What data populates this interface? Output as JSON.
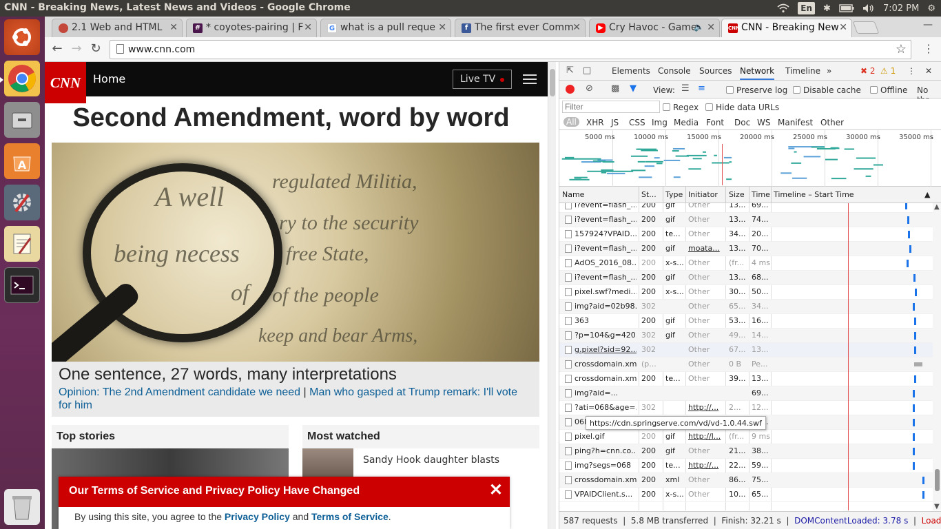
{
  "window": {
    "title": "CNN - Breaking News, Latest News and Videos - Google Chrome"
  },
  "indicators": {
    "lang": "En",
    "time": "7:02 PM"
  },
  "tabs": [
    {
      "label": "2.1 Web and HTML",
      "color": "#c3473a"
    },
    {
      "label": "* coyotes-pairing | F",
      "color": "#4a154b"
    },
    {
      "label": "what is a pull reque",
      "color": "#4285f4"
    },
    {
      "label": "The first ever Comm",
      "color": "#3b5998"
    },
    {
      "label": "Cry Havoc - Game",
      "color": "#ff0000"
    },
    {
      "label": "CNN - Breaking New",
      "color": "#cc0000"
    }
  ],
  "omnibox": {
    "url": "www.cnn.com"
  },
  "cnn": {
    "logo": "CNN",
    "home": "Home",
    "live_tv": "Live TV",
    "headline": "Second Amendment, word by word",
    "hero_text": [
      "A well",
      "regulated Militia,",
      "ry to the security",
      "being necess",
      "free State,",
      "of",
      "of the people",
      "keep and bear Arms,"
    ],
    "caption_title": "One sentence, 27 words, many interpretations",
    "caption_link1": "Opinion: The 2nd Amendment candidate we need",
    "caption_sep": "|",
    "caption_link2": "Man who gasped at Trump remark: I'll vote for him",
    "top_stories": "Top stories",
    "most_watched": "Most watched",
    "mw_snippet": "Sandy Hook daughter blasts",
    "tos_title": "Our Terms of Service and Privacy Policy Have Changed",
    "tos_prefix": "By using this site, you agree to the ",
    "tos_privacy": "Privacy Policy",
    "tos_and": " and ",
    "tos_terms": "Terms of Service",
    "tos_end": "."
  },
  "devtools": {
    "tabs": [
      "Elements",
      "Console",
      "Sources",
      "Network",
      "Timeline"
    ],
    "active_tab": "Network",
    "errors": "2",
    "warnings": "1",
    "view_label": "View:",
    "preserve_log": "Preserve log",
    "disable_cache": "Disable cache",
    "offline": "Offline",
    "throttle": "No thr",
    "filter_placeholder": "Filter",
    "regex": "Regex",
    "hide_data_urls": "Hide data URLs",
    "types": [
      "All",
      "XHR",
      "JS",
      "CSS",
      "Img",
      "Media",
      "Font",
      "Doc",
      "WS",
      "Manifest",
      "Other"
    ],
    "ticks": [
      "5000 ms",
      "10000 ms",
      "15000 ms",
      "20000 ms",
      "25000 ms",
      "30000 ms",
      "35000 ms"
    ],
    "columns": [
      "Name",
      "St...",
      "Type",
      "Initiator",
      "Size",
      "Time",
      "Timeline – Start Time"
    ],
    "rows": [
      {
        "name": "i?event=flash_...",
        "status": "200",
        "type": "gif",
        "initiator": "Other",
        "size": "13...",
        "time": "69..."
      },
      {
        "name": "i?event=flash_...",
        "status": "200",
        "type": "gif",
        "initiator": "Other",
        "size": "13...",
        "time": "74..."
      },
      {
        "name": "157924?VPAID...",
        "status": "200",
        "type": "te...",
        "initiator": "Other",
        "size": "34...",
        "time": "20..."
      },
      {
        "name": "i?event=flash_...",
        "status": "200",
        "type": "gif",
        "initiator": "moata...",
        "size": "13...",
        "time": "70..."
      },
      {
        "name": "AdOS_2016_08...",
        "status": "200",
        "type": "x-s...",
        "initiator": "Other",
        "size": "(fr...",
        "time": "4 ms"
      },
      {
        "name": "i?event=flash_...",
        "status": "200",
        "type": "gif",
        "initiator": "Other",
        "size": "13...",
        "time": "68..."
      },
      {
        "name": "pixel.swf?medi...",
        "status": "200",
        "type": "x-s...",
        "initiator": "Other",
        "size": "30...",
        "time": "50..."
      },
      {
        "name": "img?aid=02b98...",
        "status": "302",
        "type": "",
        "initiator": "Other",
        "size": "65...",
        "time": "34..."
      },
      {
        "name": "363",
        "status": "200",
        "type": "gif",
        "initiator": "Other",
        "size": "53...",
        "time": "16..."
      },
      {
        "name": "?p=104&g=420...",
        "status": "302",
        "type": "gif",
        "initiator": "Other",
        "size": "49...",
        "time": "14..."
      },
      {
        "name": "g.pixel?sid=92...",
        "status": "302",
        "type": "",
        "initiator": "Other",
        "size": "67...",
        "time": "13..."
      },
      {
        "name": "crossdomain.xml",
        "status": "(p...",
        "type": "",
        "initiator": "Other",
        "size": "0 B",
        "time": "Pe..."
      },
      {
        "name": "crossdomain.xml",
        "status": "200",
        "type": "te...",
        "initiator": "Other",
        "size": "39...",
        "time": "13..."
      },
      {
        "name": "img?aid=...",
        "status": "",
        "type": "",
        "initiator": "",
        "size": "",
        "time": "69..."
      },
      {
        "name": "?ati=068&age=...",
        "status": "302",
        "type": "",
        "initiator": "http://...",
        "size": "2...",
        "time": "12..."
      },
      {
        "name": "06DuMagltow...",
        "status": "200",
        "type": "te...",
        "initiator": "Other",
        "size": "1...",
        "time": "45..."
      },
      {
        "name": "pixel.gif",
        "status": "200",
        "type": "gif",
        "initiator": "http://l...",
        "size": "(fr...",
        "time": "9 ms"
      },
      {
        "name": "ping?h=cnn.co...",
        "status": "200",
        "type": "gif",
        "initiator": "Other",
        "size": "21...",
        "time": "38..."
      },
      {
        "name": "img?segs=068",
        "status": "200",
        "type": "te...",
        "initiator": "http://...",
        "size": "22...",
        "time": "59..."
      },
      {
        "name": "crossdomain.xml",
        "status": "200",
        "type": "xml",
        "initiator": "Other",
        "size": "86...",
        "time": "75..."
      },
      {
        "name": "VPAIDClient.s...",
        "status": "200",
        "type": "x-s...",
        "initiator": "Other",
        "size": "10...",
        "time": "65..."
      }
    ],
    "tooltip": "https://cdn.springserve.com/vd/vd-1.0.44.swf",
    "status": {
      "requests": "587 requests",
      "transferred": "5.8 MB transferred",
      "finish": "Finish: 32.21 s",
      "dcl": "DOMContentLoaded: 3.78 s",
      "load": "Load: 15...."
    }
  }
}
